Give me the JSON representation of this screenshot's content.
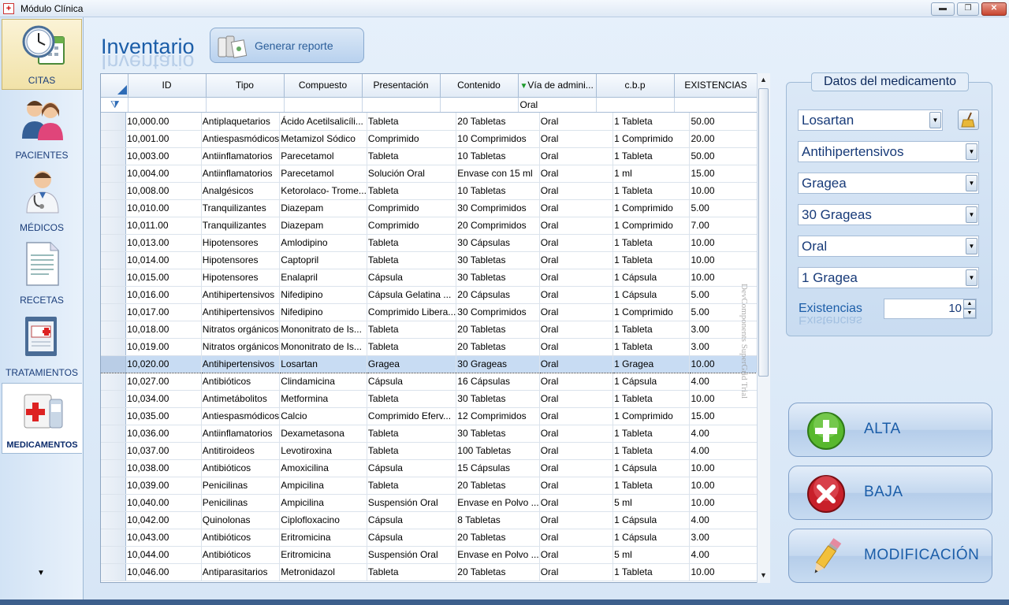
{
  "window": {
    "title": "Módulo Clínica",
    "app_icon": "+",
    "minimize_glyph": "▬",
    "maximize_glyph": "❐",
    "close_glyph": "✕"
  },
  "sidebar": {
    "items": [
      {
        "label": "CITAS",
        "icon": "clock-calendar-icon"
      },
      {
        "label": "PACIENTES",
        "icon": "patients-icon"
      },
      {
        "label": "MÉDICOS",
        "icon": "doctor-icon"
      },
      {
        "label": "RECETAS",
        "icon": "prescription-document-icon"
      },
      {
        "label": "TRATAMIENTOS",
        "icon": "treatment-clipboard-icon"
      },
      {
        "label": "MEDICAMENTOS",
        "icon": "medicine-box-icon"
      }
    ],
    "more_arrow": "▼"
  },
  "header": {
    "title": "Inventario",
    "report_button": "Generar reporte"
  },
  "grid": {
    "columns": [
      "ID",
      "Tipo",
      "Compuesto",
      "Presentación",
      "Contenido",
      "Vía de admini...",
      "c.b.p",
      "EXISTENCIAS"
    ],
    "filter_row": [
      "",
      "",
      "",
      "",
      "",
      "Oral",
      "",
      ""
    ],
    "rows": [
      [
        "10,000.00",
        "Antiplaquetarios",
        "Ácido Acetilsalicíli...",
        "Tableta",
        "20 Tabletas",
        "Oral",
        "1 Tableta",
        "50.00"
      ],
      [
        "10,001.00",
        "Antiespasmódicos",
        "Metamizol Sódico",
        "Comprimido",
        "10 Comprimidos",
        "Oral",
        "1 Comprimido",
        "20.00"
      ],
      [
        "10,003.00",
        "Antiinflamatorios",
        "Parecetamol",
        "Tableta",
        "10 Tabletas",
        "Oral",
        "1 Tableta",
        "50.00"
      ],
      [
        "10,004.00",
        "Antiinflamatorios",
        "Parecetamol",
        "Solución Oral",
        "Envase con 15 ml",
        "Oral",
        "1 ml",
        "15.00"
      ],
      [
        "10,008.00",
        "Analgésicos",
        "Ketorolaco- Trome...",
        "Tableta",
        "10 Tabletas",
        "Oral",
        "1 Tableta",
        "10.00"
      ],
      [
        "10,010.00",
        "Tranquilizantes",
        "Diazepam",
        "Comprimido",
        "30 Comprimidos",
        "Oral",
        "1 Comprimido",
        "5.00"
      ],
      [
        "10,011.00",
        "Tranquilizantes",
        "Diazepam",
        "Comprimido",
        "20 Comprimidos",
        "Oral",
        "1 Comprimido",
        "7.00"
      ],
      [
        "10,013.00",
        "Hipotensores",
        "Amlodipino",
        "Tableta",
        "30 Cápsulas",
        "Oral",
        "1 Tableta",
        "10.00"
      ],
      [
        "10,014.00",
        "Hipotensores",
        "Captopril",
        "Tableta",
        "30 Tabletas",
        "Oral",
        "1 Tableta",
        "10.00"
      ],
      [
        "10,015.00",
        "Hipotensores",
        "Enalapril",
        "Cápsula",
        "30 Tabletas",
        "Oral",
        "1 Cápsula",
        "10.00"
      ],
      [
        "10,016.00",
        "Antihipertensivos",
        "Nifedipino",
        "Cápsula Gelatina ...",
        "20 Cápsulas",
        "Oral",
        "1 Cápsula",
        "5.00"
      ],
      [
        "10,017.00",
        "Antihipertensivos",
        "Nifedipino",
        "Comprimido Libera...",
        "30 Comprimidos",
        "Oral",
        "1 Comprimido",
        "5.00"
      ],
      [
        "10,018.00",
        "Nitratos orgánicos",
        "Mononitrato de Is...",
        "Tableta",
        "20 Tabletas",
        "Oral",
        "1 Tableta",
        "3.00"
      ],
      [
        "10,019.00",
        "Nitratos orgánicos",
        "Mononitrato de Is...",
        "Tableta",
        "20 Tabletas",
        "Oral",
        "1 Tableta",
        "3.00"
      ],
      [
        "10,020.00",
        "Antihipertensivos",
        "Losartan",
        "Gragea",
        "30 Grageas",
        "Oral",
        "1 Gragea",
        "10.00"
      ],
      [
        "10,027.00",
        "Antibióticos",
        "Clindamicina",
        "Cápsula",
        "16 Cápsulas",
        "Oral",
        "1 Cápsula",
        "4.00"
      ],
      [
        "10,034.00",
        "Antimetábolitos",
        "Metformina",
        "Tableta",
        "30 Tabletas",
        "Oral",
        "1 Tableta",
        "10.00"
      ],
      [
        "10,035.00",
        "Antiespasmódicos",
        "Calcio",
        "Comprimido Eferv...",
        "12 Comprimidos",
        "Oral",
        "1 Comprimido",
        "15.00"
      ],
      [
        "10,036.00",
        "Antiinflamatorios",
        "Dexametasona",
        "Tableta",
        "30 Tabletas",
        "Oral",
        "1 Tableta",
        "4.00"
      ],
      [
        "10,037.00",
        "Antitiroideos",
        "Levotiroxina",
        "Tableta",
        "100 Tabletas",
        "Oral",
        "1 Tableta",
        "4.00"
      ],
      [
        "10,038.00",
        "Antibióticos",
        "Amoxicilina",
        "Cápsula",
        "15 Cápsulas",
        "Oral",
        "1 Cápsula",
        "10.00"
      ],
      [
        "10,039.00",
        "Penicilinas",
        "Ampicilina",
        "Tableta",
        "20 Tabletas",
        "Oral",
        "1 Tableta",
        "10.00"
      ],
      [
        "10,040.00",
        "Penicilinas",
        "Ampicilina",
        "Suspensión Oral",
        "Envase en Polvo ...",
        "Oral",
        "5 ml",
        "10.00"
      ],
      [
        "10,042.00",
        "Quinolonas",
        "Ciplofloxacino",
        "Cápsula",
        "8 Tabletas",
        "Oral",
        "1 Cápsula",
        "4.00"
      ],
      [
        "10,043.00",
        "Antibióticos",
        "Eritromicina",
        "Cápsula",
        "20 Tabletas",
        "Oral",
        "1 Cápsula",
        "3.00"
      ],
      [
        "10,044.00",
        "Antibióticos",
        "Eritromicina",
        "Suspensión Oral",
        "Envase en Polvo ...",
        "Oral",
        "5 ml",
        "4.00"
      ],
      [
        "10,046.00",
        "Antiparasitarios",
        "Metronidazol",
        "Tableta",
        "20 Tabletas",
        "Oral",
        "1 Tableta",
        "10.00"
      ]
    ],
    "selected_row": 14,
    "watermark": "DevComponents SuperGrid Trial"
  },
  "datos": {
    "title": "Datos del medicamento",
    "compuesto": "Losartan",
    "tipo": "Antihipertensivos",
    "presentacion": "Gragea",
    "contenido": "30 Grageas",
    "via": "Oral",
    "cbp": "1 Gragea",
    "existencias_label": "Existencias",
    "existencias_value": "10"
  },
  "actions": {
    "alta": "ALTA",
    "baja": "BAJA",
    "modificacion": "MODIFICACIÓN"
  }
}
